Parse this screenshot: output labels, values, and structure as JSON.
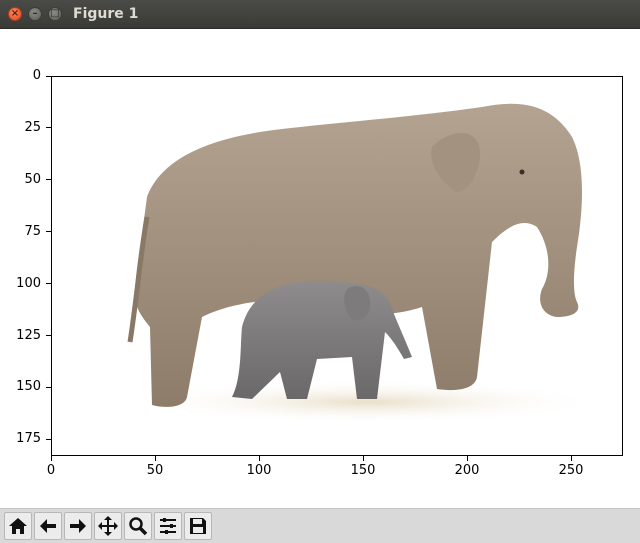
{
  "window": {
    "title": "Figure 1",
    "buttons": {
      "close": "×",
      "minimize": "–",
      "maximize": "□"
    }
  },
  "chart_data": {
    "type": "image",
    "image_subject": "adult elephant with calf",
    "xlim": [
      0,
      275
    ],
    "ylim": [
      183,
      0
    ],
    "xticks": [
      "0",
      "50",
      "100",
      "150",
      "200",
      "250"
    ],
    "yticks": [
      "0",
      "25",
      "50",
      "75",
      "100",
      "125",
      "150",
      "175"
    ],
    "title": "",
    "xlabel": "",
    "ylabel": ""
  },
  "toolbar": {
    "icons": [
      "home-icon",
      "back-arrow-icon",
      "forward-arrow-icon",
      "pan-icon",
      "zoom-icon",
      "configure-subplots-icon",
      "save-icon"
    ]
  }
}
